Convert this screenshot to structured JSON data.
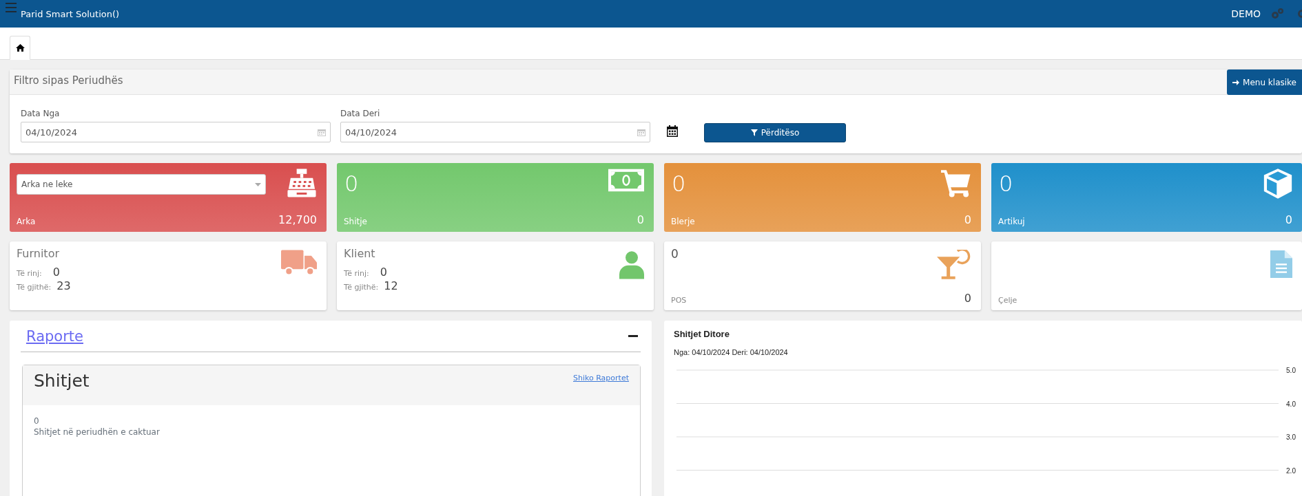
{
  "topbar": {
    "title": "Parid Smart Solution()",
    "user": "DEMO"
  },
  "tabs": [
    {
      "selected": true
    }
  ],
  "filter": {
    "title": "Filtro sipas Periudhës",
    "classic_button": "Menu klasike",
    "update_button": "Përditëso",
    "fields": [
      {
        "label": "Data Nga",
        "value": "04/10/2024"
      },
      {
        "label": "Data Deri",
        "value": "04/10/2024"
      }
    ]
  },
  "stat_cards": [
    {
      "kind": "select",
      "select_value": "Arka ne leke",
      "label": "Arka",
      "amount": "12,700",
      "color": "#d94f4f"
    },
    {
      "kind": "count",
      "count": "0",
      "label": "Shitje",
      "amount": "0",
      "color": "#73c86d"
    },
    {
      "kind": "count",
      "count": "0",
      "label": "Blerje",
      "amount": "0",
      "color": "#e4913c"
    },
    {
      "kind": "count",
      "count": "0",
      "label": "Artikuj",
      "amount": "0",
      "color": "#1f90cb"
    }
  ],
  "info_cards": [
    {
      "kind": "people",
      "title": "Furnitor",
      "rows": [
        {
          "label": "Të rinj:",
          "value": "0"
        },
        {
          "label": "Të gjithë:",
          "value": "23"
        }
      ],
      "color": "#f0a088"
    },
    {
      "kind": "people",
      "title": "Klient",
      "rows": [
        {
          "label": "Të rinj:",
          "value": "0"
        },
        {
          "label": "Të gjithë:",
          "value": "12"
        }
      ],
      "color": "#72c66c"
    },
    {
      "kind": "count",
      "count": "0",
      "label": "POS",
      "amount": "0",
      "color": "#e9a25a"
    },
    {
      "kind": "label",
      "label": "Çelje",
      "color": "#93cde8"
    }
  ],
  "reports": {
    "title": "Raporte",
    "section": {
      "title": "Shitjet",
      "link": "Shiko Raportet",
      "count": "0",
      "caption": "Shitjet në periudhën e caktuar"
    }
  },
  "chart": {
    "title": "Shitjet Ditore",
    "subtitle": "Nga: 04/10/2024 Deri: 04/10/2024",
    "axis_labels": [
      "5.0",
      "4.0",
      "3.0",
      "2.0"
    ]
  }
}
